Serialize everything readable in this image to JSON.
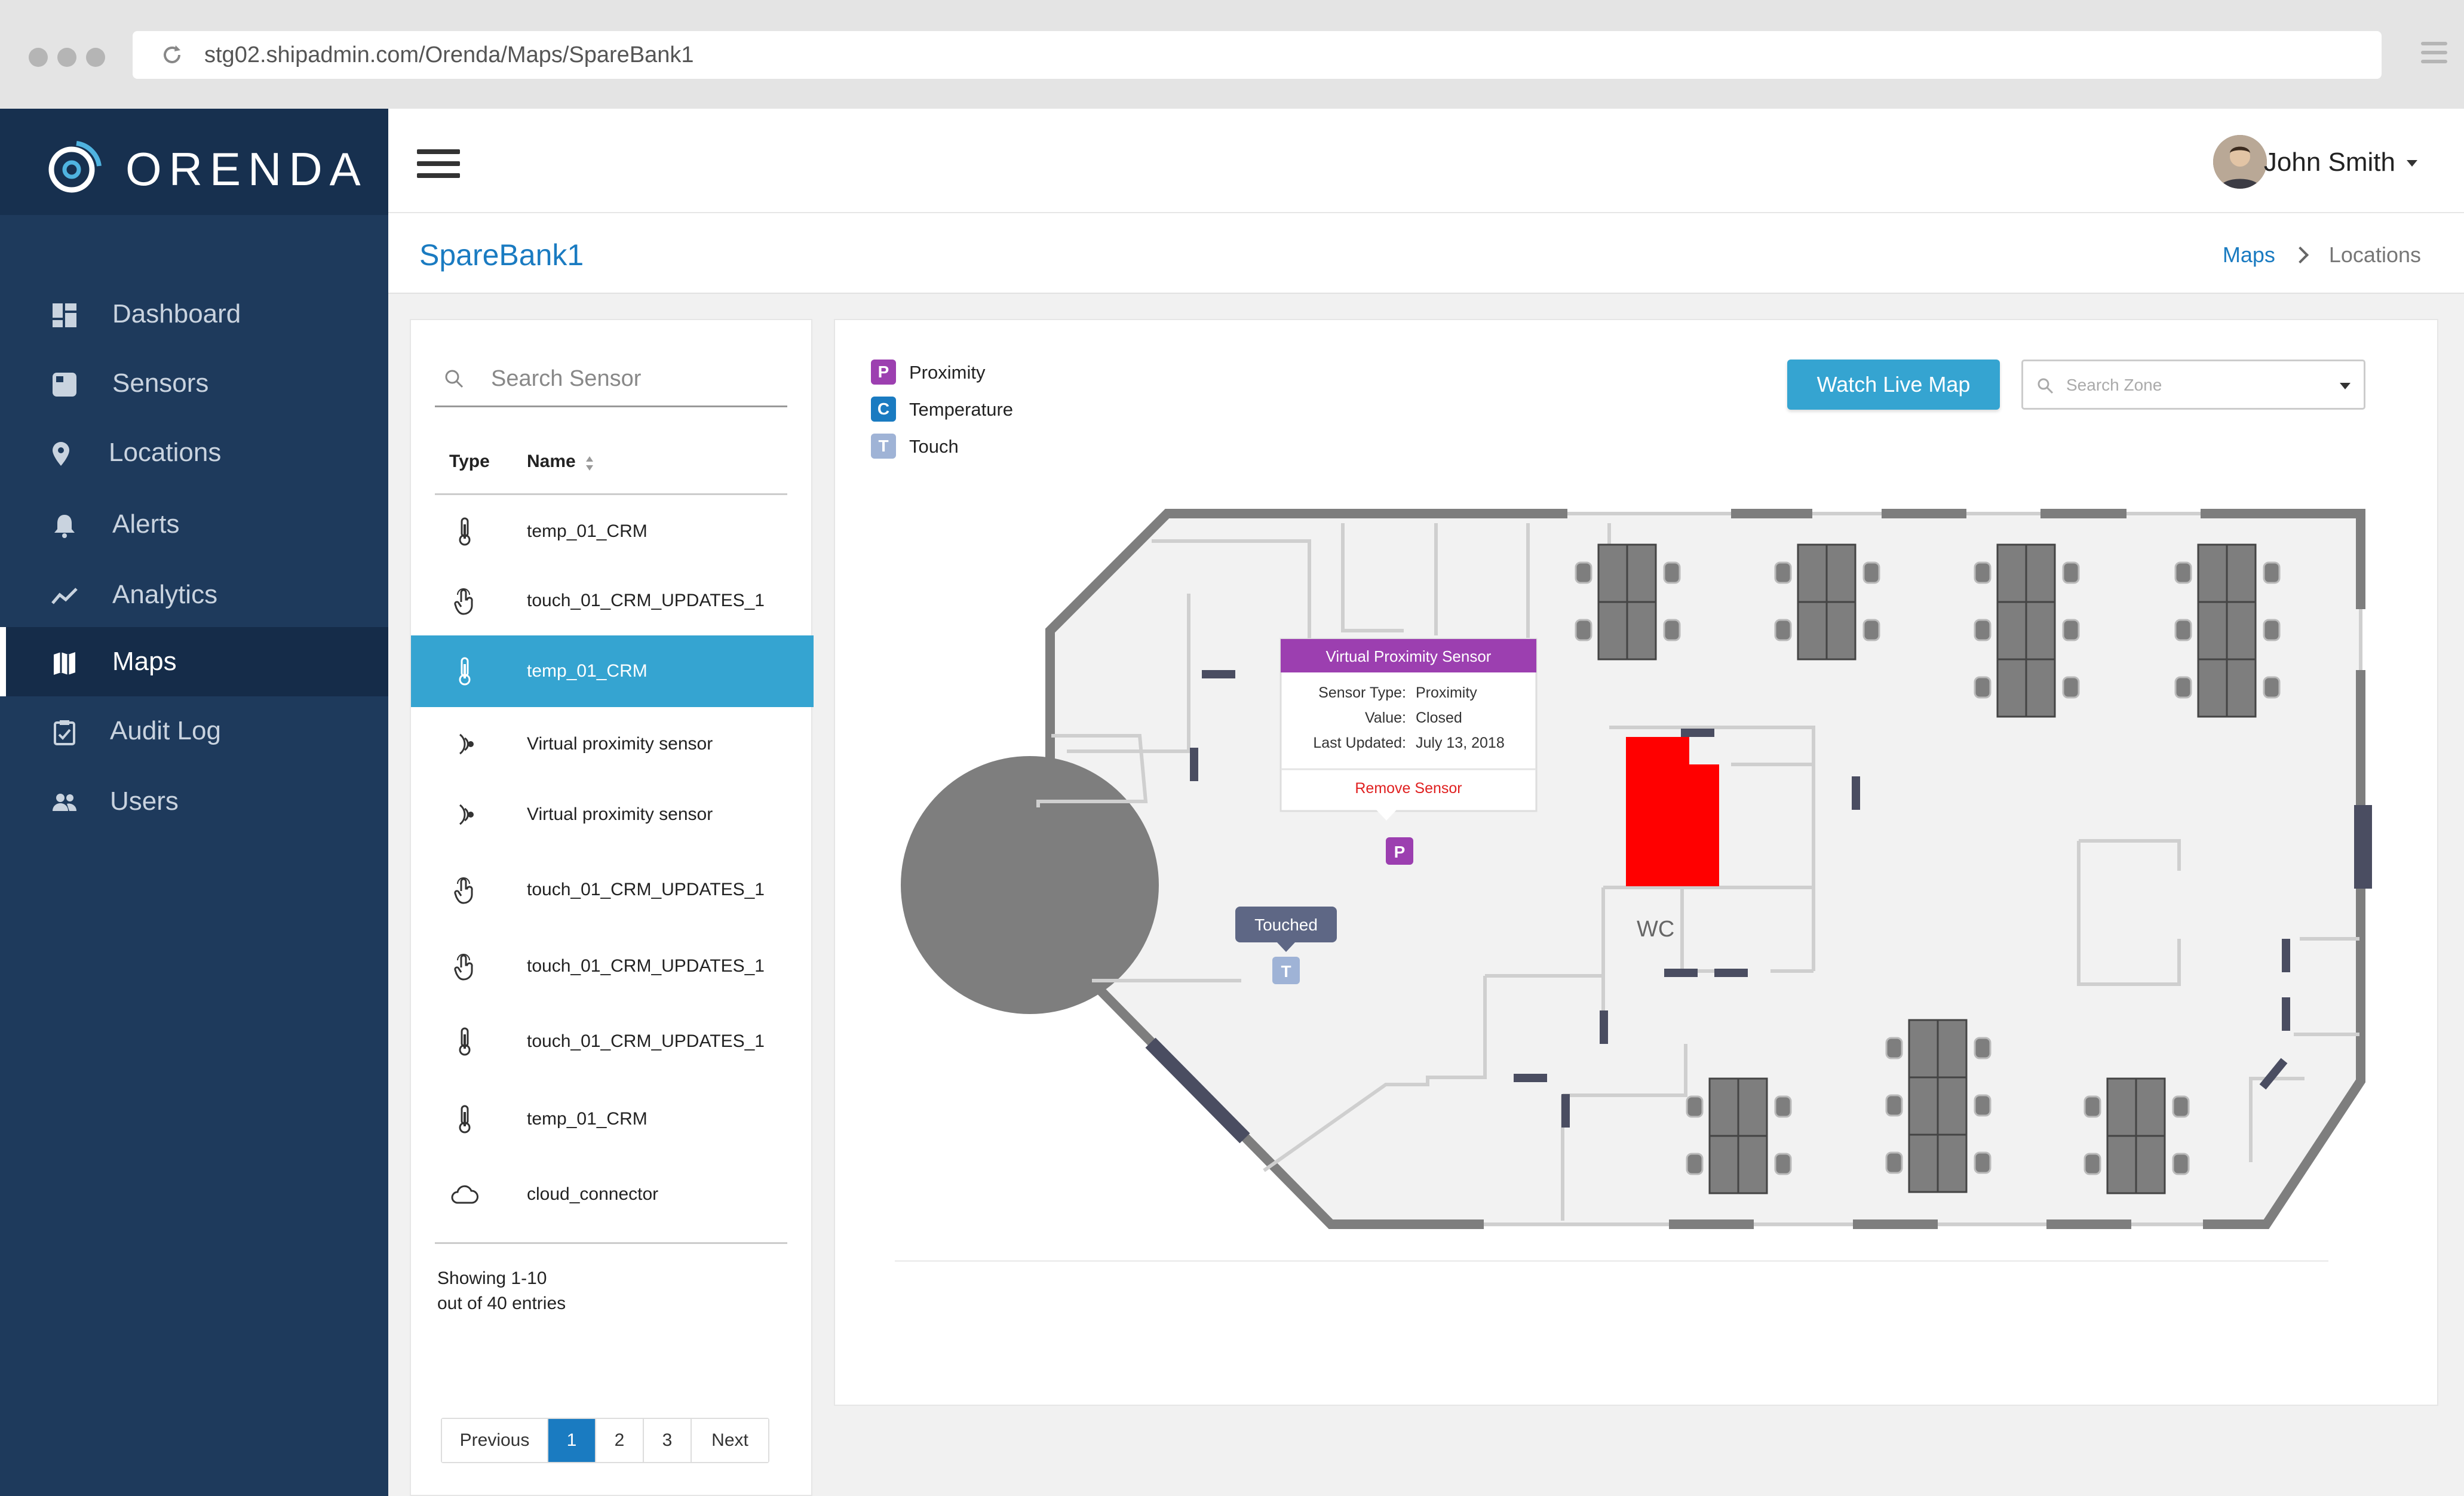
{
  "browser": {
    "url": "stg02.shipadmin.com/Orenda/Maps/SpareBank1"
  },
  "brand": {
    "name": "ORENDA"
  },
  "colors": {
    "sidebar": "#1e3a5c",
    "accent": "#35a4d1",
    "link": "#1a7bc1",
    "proximity": "#9c3fb0",
    "temperature": "#1a7bc1",
    "touch": "#9fb3d6",
    "highlight_zone": "#ff0000"
  },
  "nav": {
    "items": [
      {
        "label": "Dashboard",
        "icon": "dashboard-icon"
      },
      {
        "label": "Sensors",
        "icon": "sensor-icon"
      },
      {
        "label": "Locations",
        "icon": "location-pin-icon"
      },
      {
        "label": "Alerts",
        "icon": "bell-icon"
      },
      {
        "label": "Analytics",
        "icon": "analytics-icon"
      },
      {
        "label": "Maps",
        "icon": "map-icon",
        "active": true
      },
      {
        "label": "Audit Log",
        "icon": "clipboard-icon"
      },
      {
        "label": "Users",
        "icon": "users-icon"
      }
    ]
  },
  "header": {
    "user_name": "John Smith"
  },
  "page": {
    "title": "SpareBank1",
    "breadcrumb": [
      "Maps",
      "Locations"
    ]
  },
  "sensor_list": {
    "search_placeholder": "Search Sensor",
    "columns": {
      "type": "Type",
      "name": "Name"
    },
    "rows": [
      {
        "type": "thermometer-icon",
        "name": "temp_01_CRM"
      },
      {
        "type": "touch-icon",
        "name": "touch_01_CRM_UPDATES_1"
      },
      {
        "type": "thermometer-icon",
        "name": "temp_01_CRM",
        "selected": true
      },
      {
        "type": "proximity-icon",
        "name": "Virtual proximity sensor"
      },
      {
        "type": "proximity-icon",
        "name": "Virtual proximity sensor"
      },
      {
        "type": "touch-icon",
        "name": "touch_01_CRM_UPDATES_1"
      },
      {
        "type": "touch-icon",
        "name": "touch_01_CRM_UPDATES_1"
      },
      {
        "type": "thermometer-icon",
        "name": "touch_01_CRM_UPDATES_1"
      },
      {
        "type": "thermometer-icon",
        "name": "temp_01_CRM"
      },
      {
        "type": "cloud-icon",
        "name": "cloud_connector"
      }
    ],
    "showing_line1": "Showing 1-10",
    "showing_line2": "out of 40 entries",
    "pagination": {
      "previous": "Previous",
      "pages": [
        "1",
        "2",
        "3"
      ],
      "current": "1",
      "next": "Next"
    }
  },
  "map": {
    "legend": [
      {
        "code": "P",
        "label": "Proximity",
        "color": "#9c3fb0"
      },
      {
        "code": "C",
        "label": "Temperature",
        "color": "#1a7bc1"
      },
      {
        "code": "T",
        "label": "Touch",
        "color": "#9fb3d6"
      }
    ],
    "watch_button": "Watch Live Map",
    "zone_placeholder": "Search Zone",
    "room_label": "WC",
    "popup": {
      "title": "Virtual Proximity Sensor",
      "type_label": "Sensor Type:",
      "type_value": "Proximity",
      "value_label": "Value:",
      "value_value": "Closed",
      "updated_label": "Last Updated:",
      "updated_value": "July 13, 2018",
      "remove": "Remove Sensor"
    },
    "proximity_marker": "P",
    "touch_marker": "T",
    "touched_badge": "Touched"
  }
}
